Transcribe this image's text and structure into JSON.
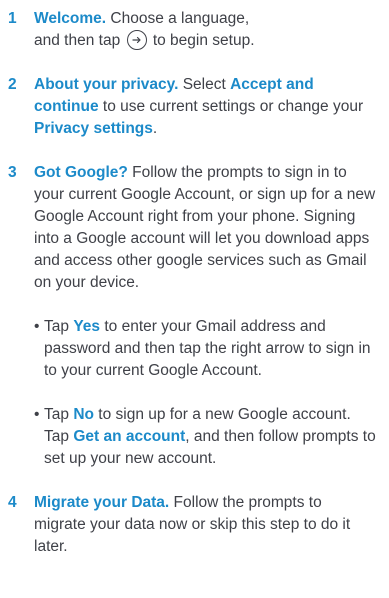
{
  "steps": [
    {
      "num": "1",
      "lead": "Welcome.",
      "text_a": " Choose a language,",
      "text_b": "and then tap",
      "text_c": "to begin setup."
    },
    {
      "num": "2",
      "lead": "About your privacy.",
      "text_a": " Select ",
      "term_a": "Accept and continue",
      "text_b": " to use current settings or change your ",
      "term_b": "Privacy settings",
      "text_c": "."
    },
    {
      "num": "3",
      "lead": "Got Google?",
      "text": " Follow the prompts to sign in to your current Google Account, or sign up for a new Google Account right from your phone. Signing into a Google account will let you download apps and access other google services such as Gmail on your device.",
      "bullets": [
        {
          "dot": "•",
          "pre": " Tap ",
          "term": "Yes",
          "post": " to enter your Gmail address and password and then tap the right arrow to sign in to your current Google Account."
        },
        {
          "dot": "•",
          "pre": " Tap ",
          "term": "No",
          "mid": " to sign up for a new Google account. Tap ",
          "term2": "Get an account",
          "post": ", and then follow prompts to set up your new account."
        }
      ]
    },
    {
      "num": "4",
      "lead": "Migrate your Data.",
      "text": " Follow the prompts to migrate your data now or skip this step to do it later."
    }
  ],
  "icons": {
    "next": "arrow-right-circle-icon"
  },
  "colors": {
    "accent": "#1c8ac9",
    "text": "#3f4148"
  }
}
